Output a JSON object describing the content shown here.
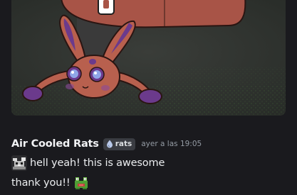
{
  "attachment": {
    "kind": "image",
    "subject": "cartoon creature artwork"
  },
  "message": {
    "username": "Air Cooled Rats",
    "server_tag": {
      "label": "rats",
      "icon": "water-drop-icon"
    },
    "timestamp": "ayer a las 19:05",
    "lines": [
      {
        "text": "hell yeah! this is awesome",
        "emoji_before": "custom-emoji-rat-pixel"
      },
      {
        "text": "thank you!!",
        "emoji_after": "custom-emoji-frog-pixel"
      }
    ]
  },
  "colors": {
    "background": "#1a1a1e",
    "username": "#f2f3f5",
    "timestamp": "#949ba4",
    "tag_bg": "#3a3c42",
    "creature_body": "#b8604e",
    "creature_ears": "#6b3a8c",
    "tail": "#a85447"
  }
}
